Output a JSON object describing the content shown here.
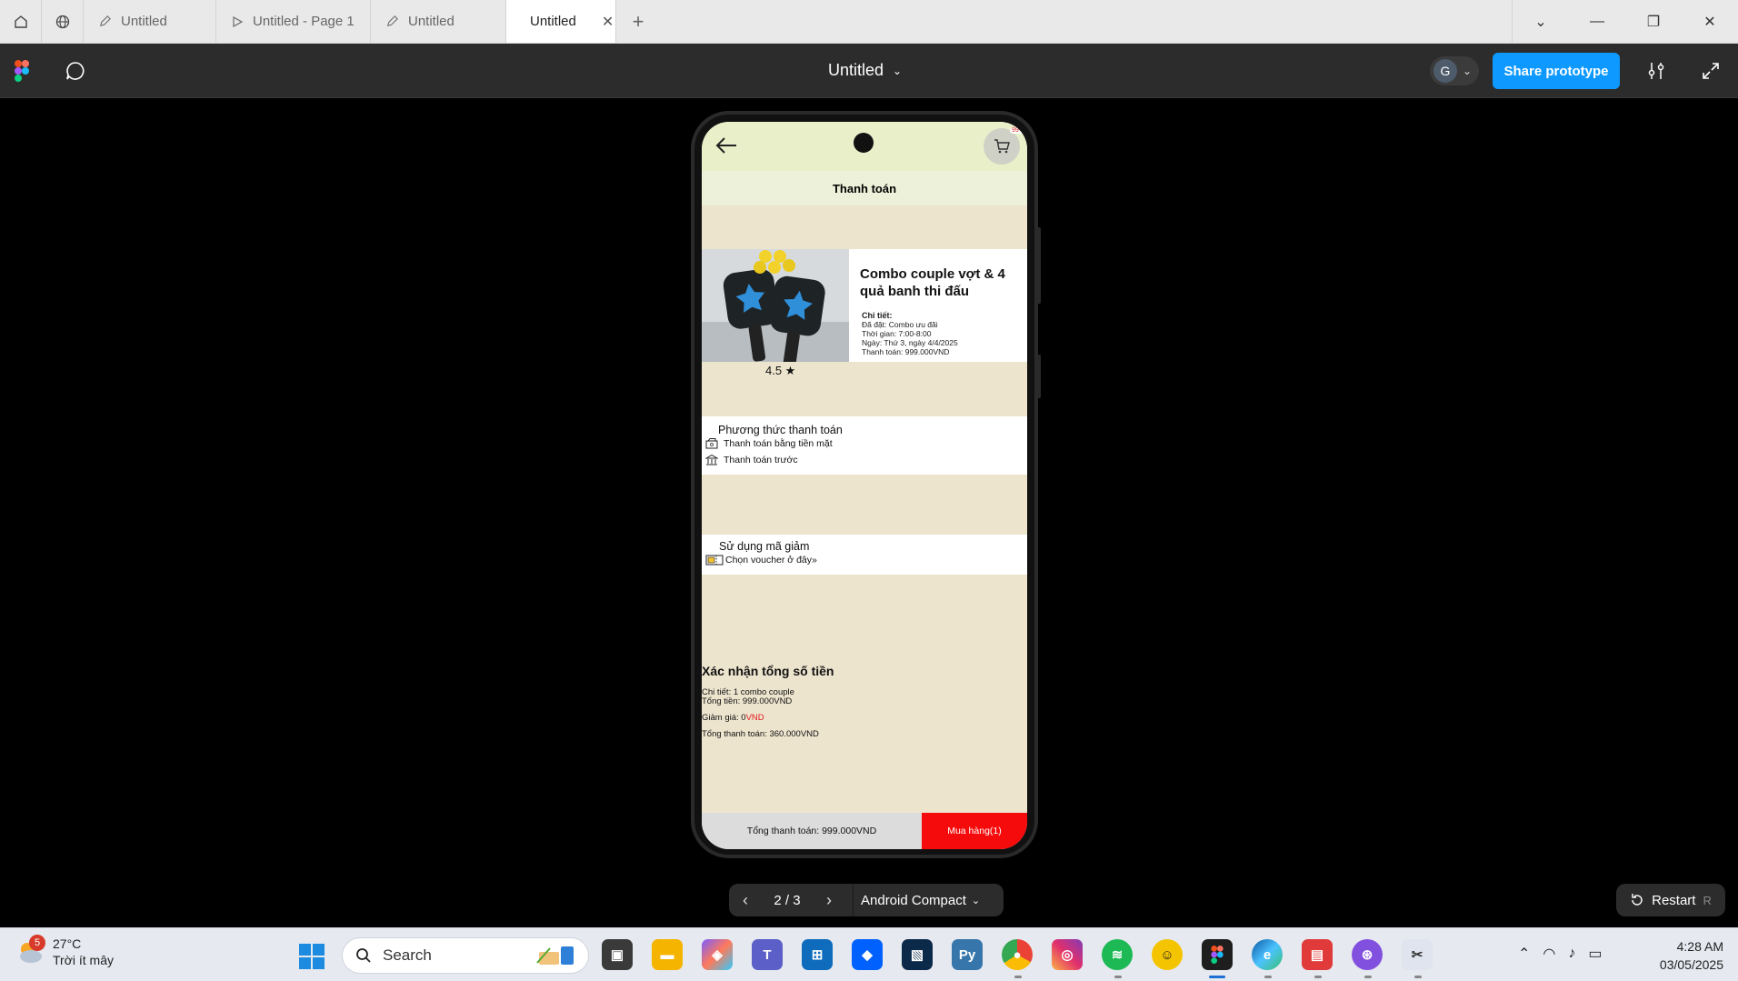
{
  "browser": {
    "tabs": [
      {
        "label": "Untitled",
        "icon": "pen-icon"
      },
      {
        "label": "Untitled - Page 1",
        "icon": "play-icon"
      },
      {
        "label": "Untitled",
        "icon": "pen-icon"
      },
      {
        "label": "Untitled",
        "icon": "play-icon",
        "active": true
      }
    ]
  },
  "toolbar": {
    "file_title": "Untitled",
    "avatar_initial": "G",
    "share_label": "Share prototype"
  },
  "app": {
    "cart_badge": "99+",
    "page_title": "Thanh toán",
    "product": {
      "name": "Combo couple vợt & 4 quả banh thi đấu",
      "details_heading": "Chi tiết:",
      "details": [
        "Đã đặt: Combo ưu đãi",
        "Thời gian: 7:00-8:00",
        "Ngày: Thứ 3, ngày 4/4/2025",
        "Thanh toán: 999.000VND"
      ],
      "rating": "4.5 ★"
    },
    "payment": {
      "title": "Phương thức thanh toán",
      "options": [
        "Thanh toán bằng tiền mặt",
        "Thanh toán trước"
      ]
    },
    "voucher": {
      "title": "Sử dụng mã giảm",
      "option": "Chọn voucher ở đây»"
    },
    "confirm": {
      "title": "Xác nhận tổng số tiền",
      "detail": "Chi tiết: 1 combo couple",
      "total": "Tổng tiền: 999.000VND",
      "discount_label": "Giảm giá:  0",
      "discount_unit": "VND",
      "grand_total": "Tổng thanh toán: 360.000VND"
    },
    "bottom": {
      "total": "Tổng thanh toán: 999.000VND",
      "buy": "Mua hàng(1)"
    }
  },
  "proto_nav": {
    "page": "2 / 3",
    "device": "Android Compact",
    "restart": "Restart",
    "restart_key": "R"
  },
  "taskbar": {
    "weather_badge": "5",
    "temperature": "27°C",
    "condition": "Trời ít mây",
    "search_placeholder": "Search",
    "time": "4:28 AM",
    "date": "03/05/2025"
  },
  "colors": {
    "figma_blue": "#0d99ff",
    "buy_red": "#f50b0b",
    "screen_bg": "#ede4ce",
    "header_green": "#e9efc8"
  }
}
